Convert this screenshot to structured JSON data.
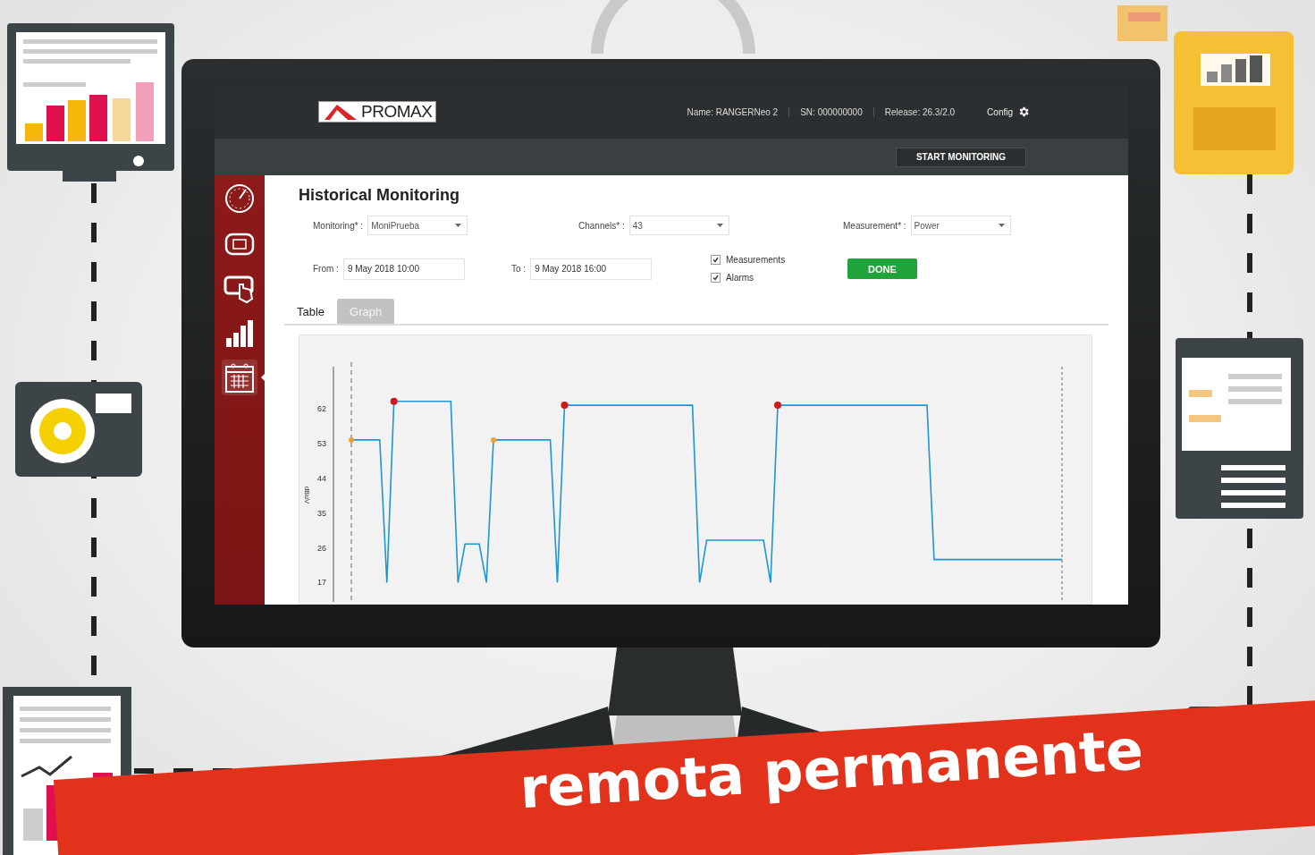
{
  "header": {
    "logo": "PROMAX",
    "info": [
      "Name: RANGERNeo 2",
      "SN: 000000000",
      "Release: 26.3/2.0"
    ],
    "config": "Config"
  },
  "toolbar": {
    "button": "START MONITORING"
  },
  "sidebar": {
    "items": [
      {
        "kind": "gauge",
        "selected": false
      },
      {
        "kind": "screen",
        "selected": false
      },
      {
        "kind": "touch",
        "selected": false
      },
      {
        "kind": "bars",
        "selected": false
      },
      {
        "kind": "calendar",
        "selected": true
      }
    ]
  },
  "page": {
    "title": "Historical Monitoring",
    "selects": [
      {
        "label": "Monitoring* :",
        "value": "MoniPrueba"
      },
      {
        "label": "Channels* :",
        "value": "43"
      },
      {
        "label": "Measurement* :",
        "value": "Power"
      }
    ],
    "from": {
      "label": "From :",
      "value": "9 May 2018 10:00"
    },
    "to": {
      "label": "To :",
      "value": "9 May 2018 16:00"
    },
    "checkboxes": [
      {
        "label": "Measurements",
        "checked": true
      },
      {
        "label": "Alarms",
        "checked": true
      }
    ],
    "done_button": "DONE",
    "tabs": [
      {
        "label": "Table",
        "selected": false
      },
      {
        "label": "Graph",
        "selected": true
      }
    ]
  },
  "chart": {
    "chart_data": {
      "type": "line",
      "ylabel": "dBuV",
      "categories": [
        null,
        null,
        null,
        null,
        null,
        null,
        null,
        null,
        null,
        null,
        null,
        null,
        null,
        null,
        null,
        null,
        null,
        null,
        null,
        null,
        null,
        null,
        null,
        null,
        null,
        null,
        null,
        null,
        null,
        null,
        null,
        null,
        null,
        null,
        null,
        null,
        null,
        null,
        null,
        null,
        null,
        null,
        null,
        null,
        null,
        null,
        null,
        null,
        null,
        null,
        null,
        null,
        null,
        null,
        null,
        null,
        null,
        null,
        null,
        null,
        null,
        null,
        null,
        null,
        null,
        null,
        null,
        null,
        null,
        null,
        null,
        null,
        null,
        null,
        null,
        null,
        null,
        null,
        null,
        null,
        null,
        null,
        null,
        null,
        null,
        null,
        null,
        null,
        null,
        null,
        null,
        null,
        null,
        null,
        null,
        null,
        null,
        null,
        null,
        null,
        null
      ],
      "series": [
        {
          "color": "#1e96d2",
          "values": [
            54,
            54,
            54,
            54,
            54,
            17,
            64,
            64,
            64,
            64,
            64,
            64,
            64,
            64,
            64,
            17,
            27,
            27,
            27,
            17,
            54,
            54,
            54,
            54,
            54,
            54,
            54,
            54,
            54,
            17,
            63,
            63,
            63,
            63,
            63,
            63,
            63,
            63,
            63,
            63,
            63,
            63,
            63,
            63,
            63,
            63,
            63,
            63,
            63,
            17,
            28,
            28,
            28,
            28,
            28,
            28,
            28,
            28,
            28,
            17,
            63,
            63,
            63,
            63,
            63,
            63,
            63,
            63,
            63,
            63,
            63,
            63,
            63,
            63,
            63,
            63,
            63,
            63,
            63,
            63,
            63,
            63,
            23,
            23,
            23,
            23,
            23,
            23,
            23,
            23,
            23,
            23,
            23,
            23,
            23,
            23,
            23,
            23,
            23,
            23,
            23
          ]
        }
      ],
      "ylim": [
        12,
        73
      ],
      "yticks": [
        17,
        26,
        35,
        44,
        53,
        62
      ]
    }
  },
  "banner": {
    "text": "remota permanente"
  }
}
